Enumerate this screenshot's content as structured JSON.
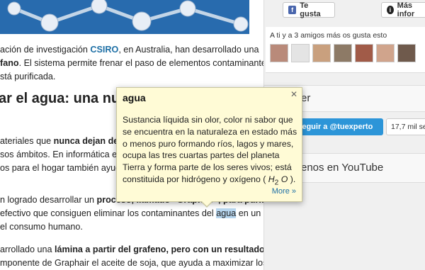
{
  "article": {
    "para1_line1_pre": "ación de investigación ",
    "para1_link": "CSIRO",
    "para1_line1_post": ", en Australia, han desarrollado una",
    "para1_line2_bold": "fano",
    "para1_line2_post": ". El sistema permite frenar el paso de elementos contaminantes,",
    "para1_line3": "stá purificada.",
    "heading": "ar el agua: una nu",
    "para2_line1_pre": "ateriales que ",
    "para2_line1_bold": "nunca dejan de s",
    "para2_line2": "sos ámbitos. En informática está",
    "para2_line3": "os para el hogar también ayuda:",
    "para3_line1_pre": "n logrado desarrollar un ",
    "para3_line1_bold": "proceso",
    "para3_line1_bold2": ", llamado \"Graphair\", para purificar",
    "para3_line2_pre": " efectivo que consiguen eliminar los contaminantes del ",
    "para3_line2_hl": "agua",
    "para3_line2_post": " en un",
    "para3_line3": "el consumo humano.",
    "para4_line1_pre": "arrollado una ",
    "para4_line1_bold": "lámina a partir del grafeno, pero con un resultado",
    "para4_line2": "mponente de Graphair el aceite de soja, que ayuda a maximizar los"
  },
  "sidebar": {
    "like_button": "Te gusta",
    "info_button": "Más infor",
    "friends_text": "A ti y a 3 amigos más os gusta esto",
    "section_title_1": "er",
    "follow_button": "Seguir a @tuexperto",
    "follow_count": "17,7 mil segu",
    "section_title_2": "enos en YouTube"
  },
  "tooltip": {
    "word": "agua",
    "definition_pre": "Sustancia líquida sin olor, color ni sabor que se encuentra en la naturaleza en estado más o menos puro formando ríos, lagos y mares, ocupa las tres cuartas partes del planeta Tierra y forma parte de los seres vivos; está constituida por hidrógeno y oxígeno ( ",
    "formula_h": "H",
    "formula_sub": "2",
    "formula_o": " O",
    "definition_post": " ).",
    "more_link": "More »",
    "close_glyph": "✕"
  },
  "colors": {
    "accent_link": "#1d6fa5",
    "follow_blue": "#2c95d8",
    "tooltip_bg": "#fffbd6",
    "highlight": "#b7d6ef"
  }
}
